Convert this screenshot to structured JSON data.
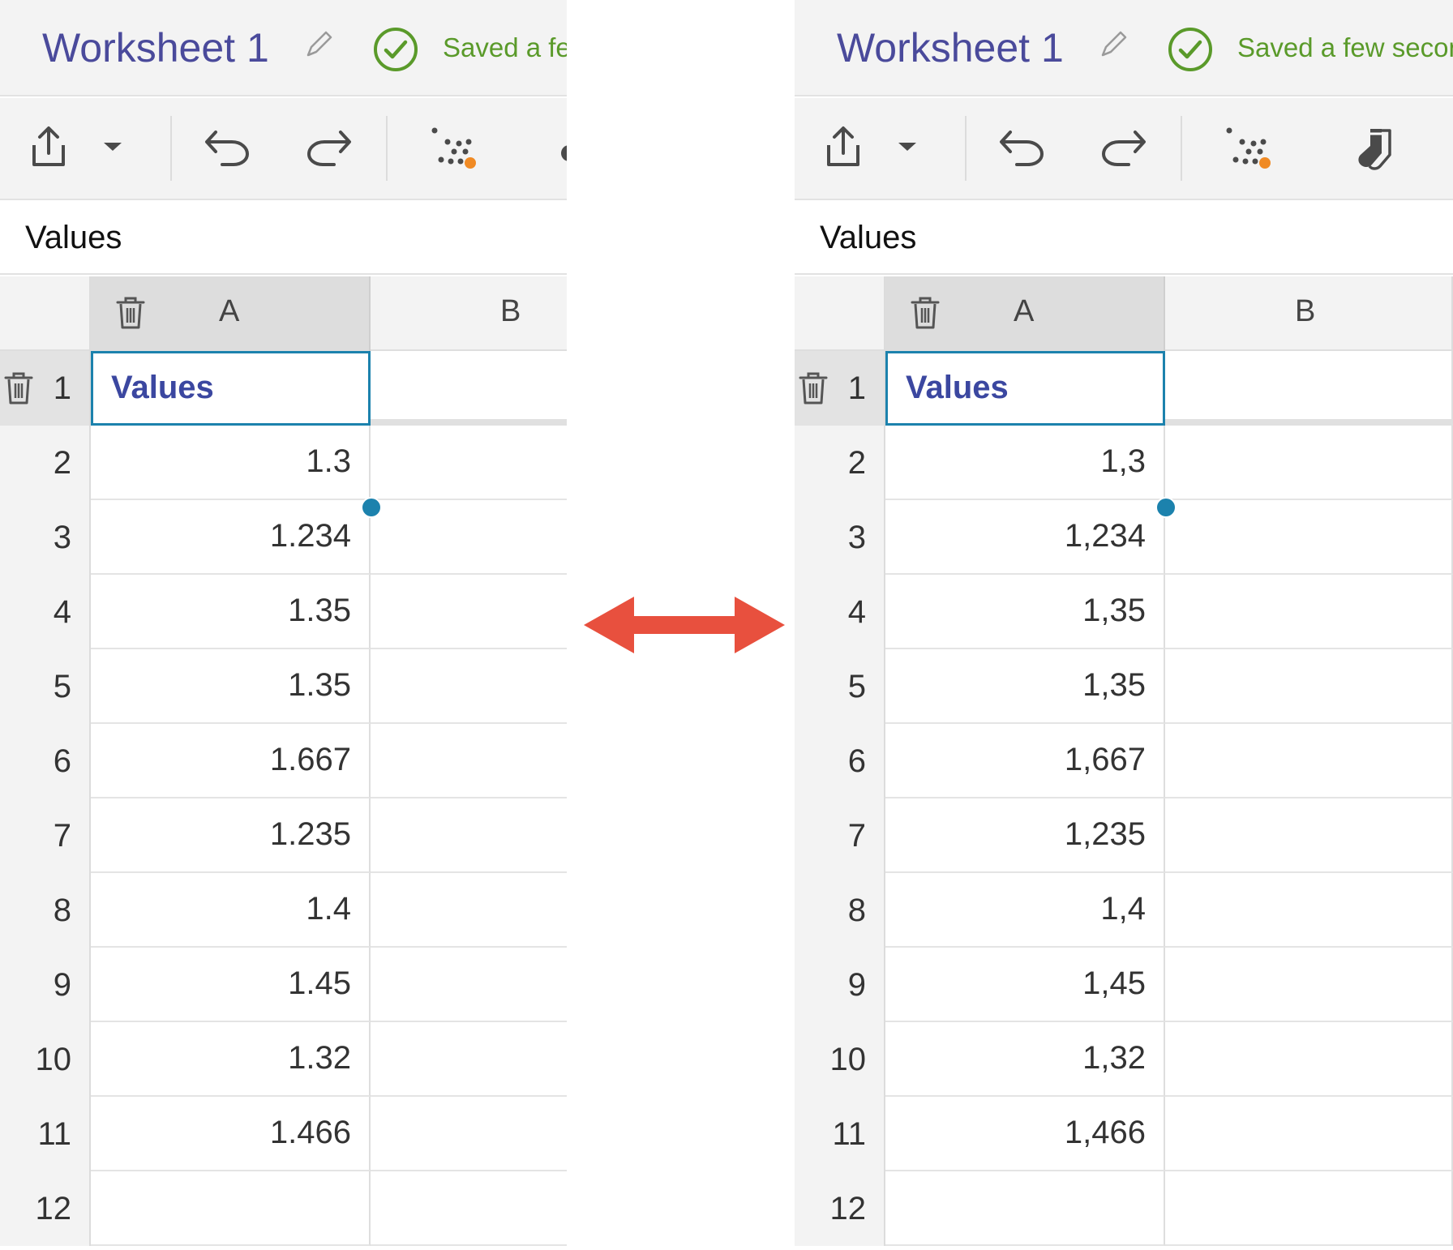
{
  "left_panel": {
    "title": "Worksheet 1",
    "save_status": "Saved a few seconds ago",
    "values_label": "Values",
    "columns": [
      "A",
      "B"
    ],
    "rows": [
      {
        "num": "1",
        "value": "Values"
      },
      {
        "num": "2",
        "value": "1.3"
      },
      {
        "num": "3",
        "value": "1.234"
      },
      {
        "num": "4",
        "value": "1.35"
      },
      {
        "num": "5",
        "value": "1.35"
      },
      {
        "num": "6",
        "value": "1.667"
      },
      {
        "num": "7",
        "value": "1.235"
      },
      {
        "num": "8",
        "value": "1.4"
      },
      {
        "num": "9",
        "value": "1.45"
      },
      {
        "num": "10",
        "value": "1.32"
      },
      {
        "num": "11",
        "value": "1.466"
      },
      {
        "num": "12",
        "value": ""
      }
    ]
  },
  "right_panel": {
    "title": "Worksheet 1",
    "save_status": "Saved a few seconds ago",
    "values_label": "Values",
    "columns": [
      "A",
      "B"
    ],
    "rows": [
      {
        "num": "1",
        "value": "Values"
      },
      {
        "num": "2",
        "value": "1,3"
      },
      {
        "num": "3",
        "value": "1,234"
      },
      {
        "num": "4",
        "value": "1,35"
      },
      {
        "num": "5",
        "value": "1,35"
      },
      {
        "num": "6",
        "value": "1,667"
      },
      {
        "num": "7",
        "value": "1,235"
      },
      {
        "num": "8",
        "value": "1,4"
      },
      {
        "num": "9",
        "value": "1,45"
      },
      {
        "num": "10",
        "value": "1,32"
      },
      {
        "num": "11",
        "value": "1,466"
      },
      {
        "num": "12",
        "value": ""
      }
    ]
  },
  "icons": {
    "edit": "pencil-icon",
    "status": "check-circle-icon",
    "export": "share-icon",
    "dropdown": "caret-down-icon",
    "undo": "undo-icon",
    "redo": "redo-icon",
    "plot": "scatter-plot-icon",
    "extra": "socks-icon",
    "delete": "trash-icon",
    "comparison": "double-arrow-icon"
  },
  "colors": {
    "title": "#4a4a9b",
    "saved": "#5a9a2a",
    "selection": "#1c82ad",
    "arrow": "#e8503e",
    "accent": "#f08a24"
  }
}
